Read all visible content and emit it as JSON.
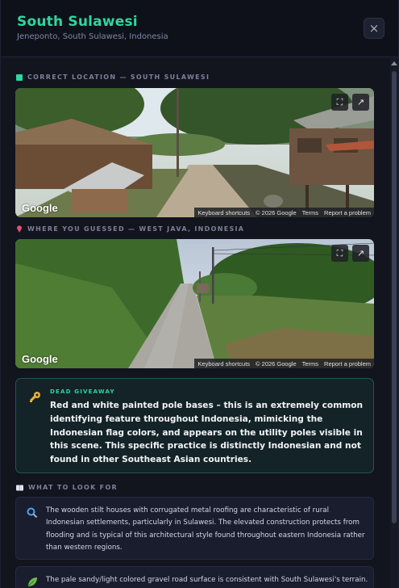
{
  "header": {
    "title": "South Sulawesi",
    "subtitle": "Jeneponto, South Sulawesi, Indonesia",
    "close_icon": "×"
  },
  "correct_section": {
    "label": "CORRECT LOCATION — SOUTH SULAWESI",
    "marker_color": "#2fd6a0"
  },
  "guess_section": {
    "label": "WHERE YOU GUESSED — WEST JAVA, INDONESIA",
    "marker_icon": "pin-icon"
  },
  "panorama": {
    "logo": "Google",
    "attribution": [
      "Keyboard shortcuts",
      "© 2026 Google",
      "Terms",
      "Report a problem"
    ],
    "fullscreen_icon": "⛶",
    "open_icon": "↗"
  },
  "giveaway": {
    "tag": "DEAD GIVEAWAY",
    "text": "Red and white painted pole bases – this is an extremely common identifying feature throughout Indonesia, mimicking the Indonesian flag colors, and appears on the utility poles visible in this scene. This specific practice is distinctly Indonesian and not found in other Southeast Asian countries."
  },
  "look_section": {
    "label": "WHAT TO LOOK FOR",
    "items": [
      {
        "icon": "magnifier-icon",
        "text": "The wooden stilt houses with corrugated metal roofing are characteristic of rural Indonesian settlements, particularly in Sulawesi. The elevated construction protects from flooding and is typical of this architectural style found throughout eastern Indonesia rather than western regions."
      },
      {
        "icon": "leaf-icon",
        "text": "The pale sandy/light colored gravel road surface is consistent with South Sulawesi's terrain."
      }
    ]
  }
}
